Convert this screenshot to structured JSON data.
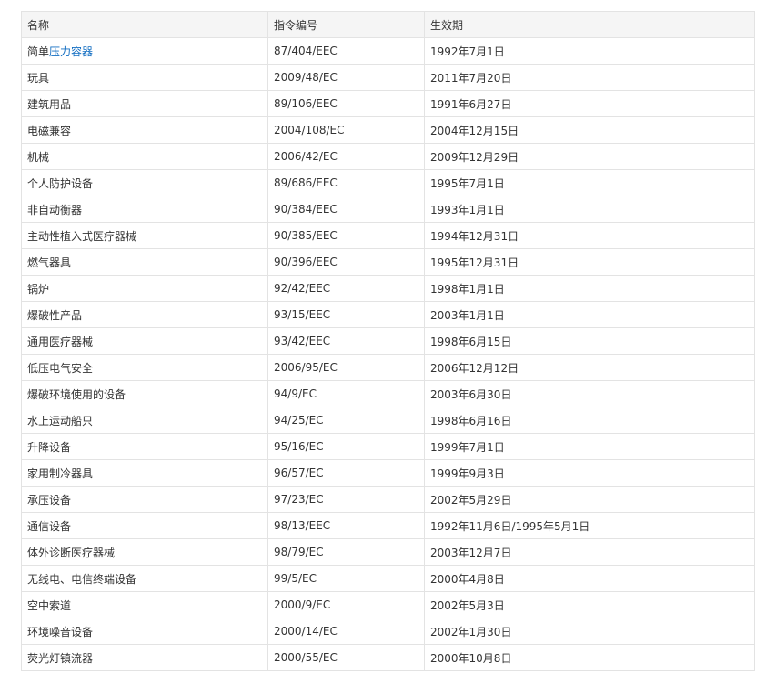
{
  "table": {
    "headers": [
      "名称",
      "指令编号",
      "生效期"
    ],
    "link_color": "#136ec2",
    "rows": [
      {
        "name_prefix": "简单",
        "name_link": "压力容器",
        "name_suffix": "",
        "code": "87/404/EEC",
        "date": "1992年7月1日"
      },
      {
        "name_prefix": "玩具",
        "name_link": "",
        "name_suffix": "",
        "code": "2009/48/EC",
        "date": "2011年7月20日"
      },
      {
        "name_prefix": "建筑用品",
        "name_link": "",
        "name_suffix": "",
        "code": "89/106/EEC",
        "date": "1991年6月27日"
      },
      {
        "name_prefix": "电磁兼容",
        "name_link": "",
        "name_suffix": "",
        "code": "2004/108/EC",
        "date": "2004年12月15日"
      },
      {
        "name_prefix": "机械",
        "name_link": "",
        "name_suffix": "",
        "code": "2006/42/EC",
        "date": "2009年12月29日"
      },
      {
        "name_prefix": "个人防护设备",
        "name_link": "",
        "name_suffix": "",
        "code": "89/686/EEC",
        "date": "1995年7月1日"
      },
      {
        "name_prefix": "非自动衡器",
        "name_link": "",
        "name_suffix": "",
        "code": "90/384/EEC",
        "date": "1993年1月1日"
      },
      {
        "name_prefix": "主动性植入式医疗器械",
        "name_link": "",
        "name_suffix": "",
        "code": "90/385/EEC",
        "date": "1994年12月31日"
      },
      {
        "name_prefix": "燃气器具",
        "name_link": "",
        "name_suffix": "",
        "code": "90/396/EEC",
        "date": "1995年12月31日"
      },
      {
        "name_prefix": "锅炉",
        "name_link": "",
        "name_suffix": "",
        "code": "92/42/EEC",
        "date": "1998年1月1日"
      },
      {
        "name_prefix": "爆破性产品",
        "name_link": "",
        "name_suffix": "",
        "code": "93/15/EEC",
        "date": "2003年1月1日"
      },
      {
        "name_prefix": "通用医疗器械",
        "name_link": "",
        "name_suffix": "",
        "code": "93/42/EEC",
        "date": "1998年6月15日"
      },
      {
        "name_prefix": "低压电气安全",
        "name_link": "",
        "name_suffix": "",
        "code": "2006/95/EC",
        "date": "2006年12月12日"
      },
      {
        "name_prefix": "爆破环境使用的设备",
        "name_link": "",
        "name_suffix": "",
        "code": "94/9/EC",
        "date": "2003年6月30日"
      },
      {
        "name_prefix": "水上运动船只",
        "name_link": "",
        "name_suffix": "",
        "code": "94/25/EC",
        "date": "1998年6月16日"
      },
      {
        "name_prefix": "升降设备",
        "name_link": "",
        "name_suffix": "",
        "code": "95/16/EC",
        "date": "1999年7月1日"
      },
      {
        "name_prefix": "家用制冷器具",
        "name_link": "",
        "name_suffix": "",
        "code": "96/57/EC",
        "date": "1999年9月3日"
      },
      {
        "name_prefix": "承压设备",
        "name_link": "",
        "name_suffix": "",
        "code": "97/23/EC",
        "date": "2002年5月29日"
      },
      {
        "name_prefix": "通信设备",
        "name_link": "",
        "name_suffix": "",
        "code": "98/13/EEC",
        "date": "1992年11月6日/1995年5月1日"
      },
      {
        "name_prefix": "体外诊断医疗器械",
        "name_link": "",
        "name_suffix": "",
        "code": "98/79/EC",
        "date": "2003年12月7日"
      },
      {
        "name_prefix": "无线电、电信终端设备",
        "name_link": "",
        "name_suffix": "",
        "code": "99/5/EC",
        "date": "2000年4月8日"
      },
      {
        "name_prefix": "空中索道",
        "name_link": "",
        "name_suffix": "",
        "code": "2000/9/EC",
        "date": "2002年5月3日"
      },
      {
        "name_prefix": "环境噪音设备",
        "name_link": "",
        "name_suffix": "",
        "code": "2000/14/EC",
        "date": "2002年1月30日"
      },
      {
        "name_prefix": "荧光灯镇流器",
        "name_link": "",
        "name_suffix": "",
        "code": "2000/55/EC",
        "date": "2000年10月8日"
      }
    ]
  }
}
